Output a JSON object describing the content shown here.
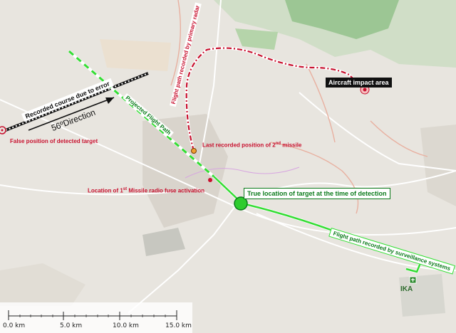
{
  "labels": {
    "recorded_course": "Recorded course due to error",
    "direction_value": "56º",
    "direction_word": "Direction",
    "projected_path": "Projected Flight Path",
    "primary_radar": "Flight path recorded by primary radar",
    "impact_area": "Aircraft impact area",
    "false_position": "False position of detected target",
    "last_position_prefix": "Last recorded position of 2",
    "last_position_sup": "nd",
    "last_position_suffix": " missile",
    "first_missile_prefix": "Location of 1",
    "first_missile_sup": "st",
    "first_missile_suffix": " Missile radio fuse activation",
    "true_location": "True location of target at the time of detection",
    "surveillance_path": "Flight path recorded by surveillance systems",
    "airport": "IKA"
  },
  "scale_bar": {
    "ticks": [
      "0.0 km",
      "5.0 km",
      "10.0 km",
      "15.0 km"
    ]
  },
  "colors": {
    "red_path": "#c8102e",
    "green_path": "#33dd33",
    "green_dark": "#0a7a1a",
    "black_path": "#111111"
  }
}
